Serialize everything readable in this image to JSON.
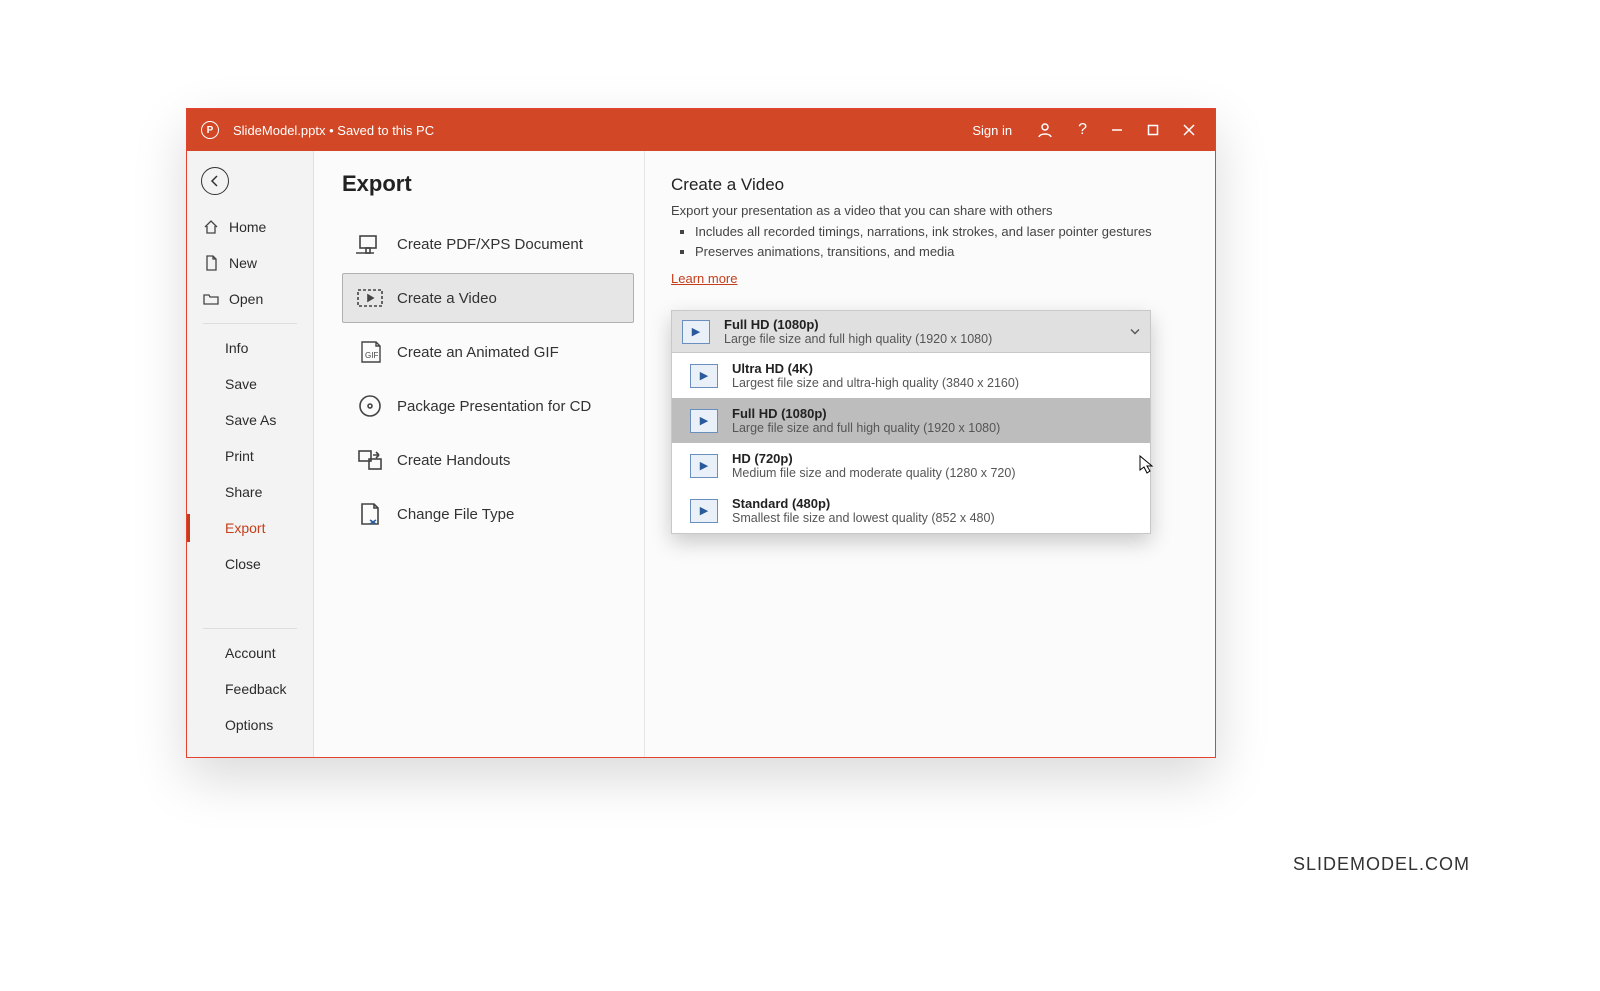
{
  "titlebar": {
    "doc_title": "SlideModel.pptx • Saved to this PC",
    "sign_in": "Sign in"
  },
  "sidebar": {
    "home": "Home",
    "new": "New",
    "open": "Open",
    "info": "Info",
    "save": "Save",
    "save_as": "Save As",
    "print": "Print",
    "share": "Share",
    "export": "Export",
    "close": "Close",
    "account": "Account",
    "feedback": "Feedback",
    "options": "Options"
  },
  "export": {
    "title": "Export",
    "opts": {
      "pdf": "Create PDF/XPS Document",
      "video": "Create a Video",
      "gif": "Create an Animated GIF",
      "cd": "Package Presentation for CD",
      "handouts": "Create Handouts",
      "filetype": "Change File Type"
    }
  },
  "detail": {
    "heading": "Create a Video",
    "sub": "Export your presentation as a video that you can share with others",
    "bullet1": "Includes all recorded timings, narrations, ink strokes, and laser pointer gestures",
    "bullet2": "Preserves animations, transitions, and media",
    "learn_more": "Learn more"
  },
  "dropdown": {
    "selected_title": "Full HD (1080p)",
    "selected_desc": "Large file size and full high quality (1920 x 1080)",
    "options": [
      {
        "title": "Ultra HD (4K)",
        "desc": "Largest file size and ultra-high quality (3840 x 2160)"
      },
      {
        "title": "Full HD (1080p)",
        "desc": "Large file size and full high quality (1920 x 1080)"
      },
      {
        "title": "HD (720p)",
        "desc": "Medium file size and moderate quality (1280 x 720)"
      },
      {
        "title": "Standard (480p)",
        "desc": "Smallest file size and lowest quality (852 x 480)"
      }
    ]
  },
  "watermark": "SLIDEMODEL.COM"
}
